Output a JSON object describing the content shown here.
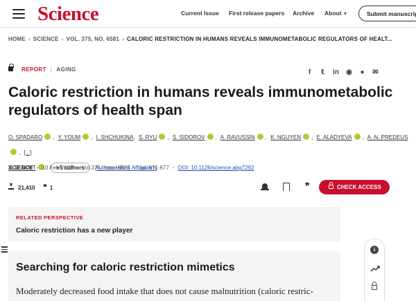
{
  "header": {
    "logo": "Science",
    "nav": {
      "current_issue": "Current Issue",
      "first_release": "First release papers",
      "archive": "Archive",
      "about": "About"
    },
    "submit": "Submit manuscript"
  },
  "breadcrumb": [
    "HOME",
    "SCIENCE",
    "VOL. 375, NO. 6581",
    "CALORIC RESTRICTION IN HUMANS REVEALS IMMUNOMETABOLIC REGULATORS OF HEALT..."
  ],
  "article": {
    "type": "REPORT",
    "subject": "AGING",
    "title": "Caloric restriction in humans reveals immunometabolic regulators of health span",
    "authors": [
      "O. SPADARO",
      "Y. YOUM",
      "I. SHCHUKINA",
      "S. RYU",
      "S. SIDOROV",
      "A. RAVUSSIN",
      "K. NGUYEN",
      "E. ALADYEVA",
      "A. N. PREDEUS",
      "V. D. DIXIT"
    ],
    "authors_ellipsis": "[...]",
    "more_authors": "+5 authors",
    "affiliations_link": "Authors Info & Affiliations",
    "journal": "SCIENCE",
    "date": "10 Feb 2022",
    "volume_issue": "Vol 375, Issue 6581",
    "pages": "pp. 671-677",
    "doi": "DOI: 10.1126/science.abg7292",
    "downloads": "21,410",
    "citations": "1",
    "check_access": "CHECK ACCESS"
  },
  "share_icons": [
    "facebook-icon",
    "twitter-icon",
    "linkedin-icon",
    "reddit-icon",
    "wechat-icon",
    "email-icon"
  ],
  "related": {
    "label": "RELATED PERSPECTIVE",
    "title": "Caloric restriction has a new player"
  },
  "section": {
    "title": "Searching for caloric restriction mimetics",
    "body": "Moderately decreased food intake that does not cause malnutrition (caloric restric-"
  },
  "colors": {
    "brand": "#c8102e",
    "link": "#1a4fb5",
    "orcid": "#a6ce39",
    "panel_bg": "#f4f4f4"
  }
}
